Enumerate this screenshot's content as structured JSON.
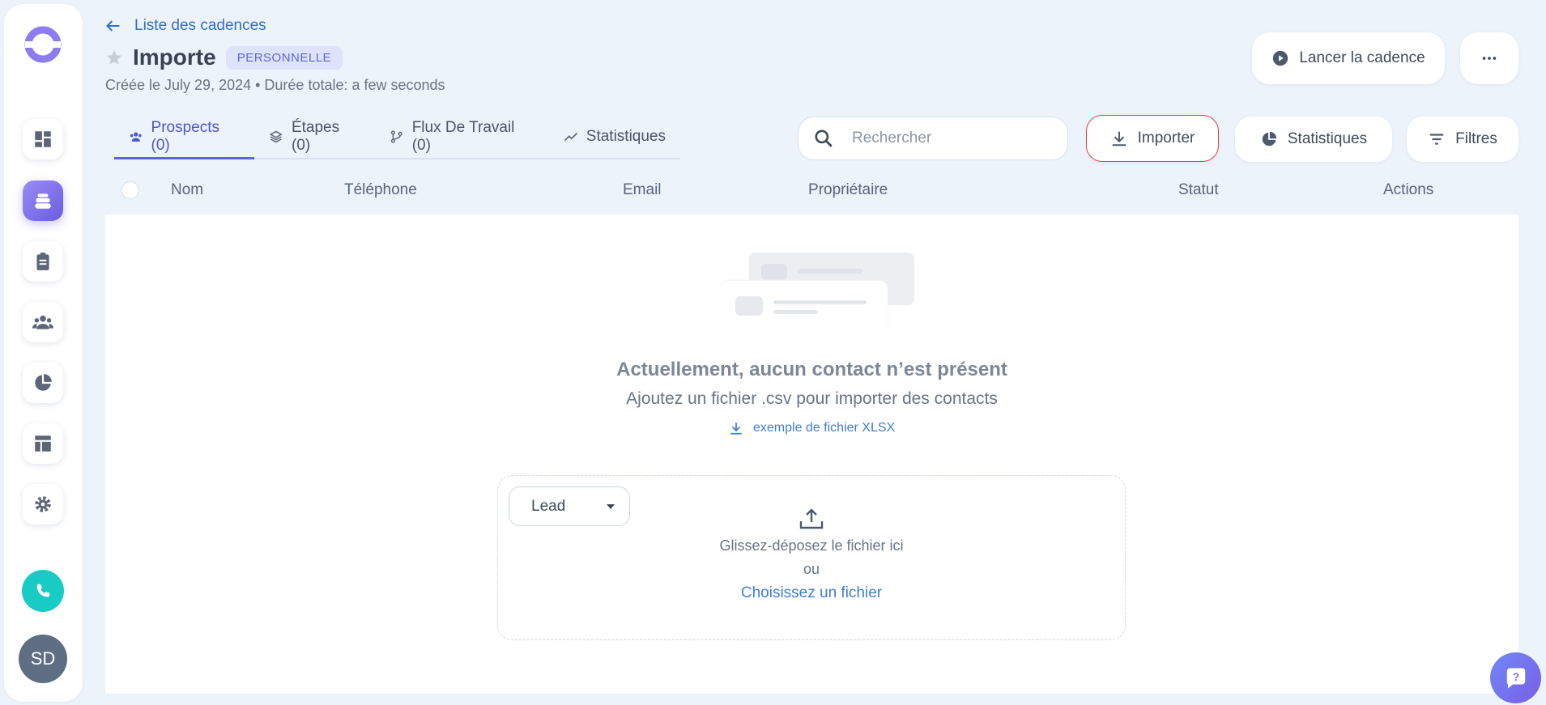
{
  "header": {
    "back_label": "Liste des cadences",
    "title": "Importe",
    "badge": "PERSONNELLE",
    "subtitle": "Créée le July 29, 2024 • Durée totale: a few seconds",
    "launch_label": "Lancer la cadence"
  },
  "tabs": [
    {
      "label": "Prospects (0)",
      "icon": "people-icon",
      "active": true
    },
    {
      "label": "Étapes (0)",
      "icon": "layers-icon",
      "active": false
    },
    {
      "label": "Flux De Travail (0)",
      "icon": "workflow-icon",
      "active": false
    },
    {
      "label": "Statistiques",
      "icon": "trend-icon",
      "active": false
    }
  ],
  "toolbar": {
    "search_placeholder": "Rechercher",
    "import_label": "Importer",
    "stats_label": "Statistiques",
    "filters_label": "Filtres"
  },
  "table": {
    "columns": [
      "Nom",
      "Téléphone",
      "Email",
      "Propriétaire",
      "Statut",
      "Actions"
    ]
  },
  "empty_state": {
    "title": "Actuellement, aucun contact n’est présent",
    "subtitle": "Ajoutez un fichier .csv pour importer des contacts",
    "example_link": "exemple de fichier XLSX"
  },
  "dropzone": {
    "type_selected": "Lead",
    "drag_text": "Glissez-déposez le fichier ici",
    "or_text": "ou",
    "choose_text": "Choisissez un fichier"
  },
  "user": {
    "initials": "SD"
  },
  "colors": {
    "accent": "#5b63dd",
    "brand": "#8b7cf0",
    "call": "#19cbc5",
    "import_border": "#e0424a"
  }
}
